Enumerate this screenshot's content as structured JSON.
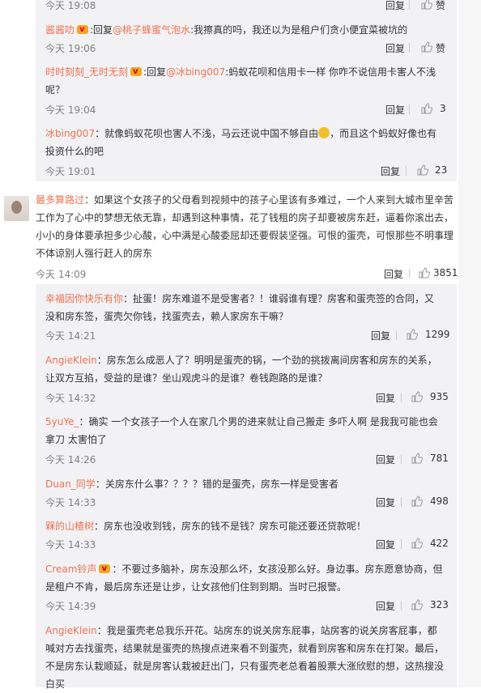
{
  "comments": [
    {
      "user": "",
      "text": "",
      "time": "今天 19:08",
      "reply": "回复",
      "likes": "赞"
    },
    {
      "user": "酱酱叻",
      "vip": true,
      "mention": "@桃子蜂蜜气泡水",
      "text": ":我擦真的吗，我还以为是租户们贪小便宜菜被坑的",
      "time": "今天 19:06",
      "reply": "回复",
      "likes": "赞"
    },
    {
      "user": "时时刻刻_无时无刻",
      "vip": true,
      "mention": "@冰bing007",
      "text": ":蚂蚁花呗和信用卡一样 你咋不说信用卡害人不浅呢？",
      "time": "今天 19:04",
      "reply": "回复",
      "likes": "3"
    },
    {
      "user": "冰bing007",
      "text": "：就像蚂蚁花呗也害人不浅，马云还说中国不够自由",
      "text2": "，而且这个蚂蚁好像也有投资什么的吧",
      "time": "今天 19:01",
      "reply": "回复",
      "likes": "23"
    },
    {
      "user": "最多算路过",
      "text": "：如果这个女孩子的父母看到视频中的孩子心里该有多难过，一个人来到大城市里辛苦工作为了心中的梦想无依无靠，却遇到这种事情，花了钱租的房子却要被房东赶，逼着你滚出去，小小的身体要承担多少心酸，心中满是心酸委屈却还要假装坚强。可恨的蛋壳，可恨那些不明事理不体谅别人强行赶人的房东",
      "time": "今天 14:09",
      "reply": "回复",
      "likes": "3851"
    },
    {
      "user": "幸福因你快乐有你",
      "text": "：扯蛋！房东难道不是受害者？！谁弱谁有理？房客和蛋壳签的合同，又没和房东签，蛋壳欠你钱，找蛋壳去，赖人家房东干嘛？",
      "time": "今天 14:21",
      "reply": "回复",
      "likes": "1299"
    },
    {
      "user": "AngieKlein",
      "text": "：房东怎么成恶人了？明明是蛋壳的锅，一个劲的挑拨离间房客和房东的关系，让双方互掐，受益的是谁？坐山观虎斗的是谁？卷钱跑路的是谁？",
      "time": "今天 14:32",
      "reply": "回复",
      "likes": "935"
    },
    {
      "user": "5yuYe_",
      "text": "：确实 一个女孩子一个人在家几个男的进来就让自己搬走 多吓人啊 是我我可能也会拿刀 太害怕了",
      "time": "今天 14:26",
      "reply": "回复",
      "likes": "781"
    },
    {
      "user": "Duan_同学",
      "text": "：关房东什么事？？？？错的是蛋壳，房东一样是受害者",
      "time": "今天 14:33",
      "reply": "回复",
      "likes": "498"
    },
    {
      "user": "槑的山楂树",
      "text": "：房东也没收到钱，房东的钱不是钱？房东可能还要还贷款呢！",
      "time": "今天 14:33",
      "reply": "回复",
      "likes": "422"
    },
    {
      "user": "Cream铃声",
      "vip": true,
      "text": "：不要过多脑补，房东没那么坏，女孩没那么好。身边事。房东愿意协商，但是租户不肯，最后房东还是让步，让女孩他们住到到期。当时已报警。",
      "time": "今天 14:39",
      "reply": "回复",
      "likes": "323"
    },
    {
      "user": "AngieKlein",
      "text": "：我是蛋壳老总我乐开花。站房东的说关房东屁事，站房客的说关房客屁事，都喊对方去找蛋壳，结果就是蛋壳的热搜点进来看不到蛋壳，就看到房客和房东在打架。最后，不是房东认栽顺延，就是房客认栽被赶出门，只有蛋壳老总看着股票大涨欣慰的想，这热搜没白买",
      "time": "",
      "reply": "",
      "likes": ""
    }
  ]
}
